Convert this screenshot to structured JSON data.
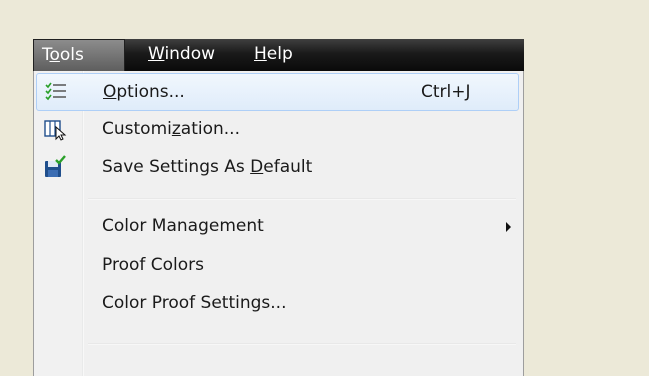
{
  "menubar": {
    "items": [
      {
        "pre": "T",
        "ul": "o",
        "post": "ols"
      },
      {
        "pre": "",
        "ul": "W",
        "post": "indow"
      },
      {
        "pre": "",
        "ul": "H",
        "post": "elp"
      }
    ]
  },
  "menu": {
    "items": [
      {
        "pre": "",
        "ul": "O",
        "post": "ptions...",
        "shortcut": "Ctrl+J",
        "icon": "options-checklist-icon"
      },
      {
        "pre": "Customi",
        "ul": "z",
        "post": "ation...",
        "icon": "customization-icon"
      },
      {
        "pre": "Save Settings As ",
        "ul": "D",
        "post": "efault",
        "icon": "save-settings-icon"
      },
      {
        "label": "Color Management"
      },
      {
        "label": "Proof Colors"
      },
      {
        "label": "Color Proof Settings..."
      }
    ]
  },
  "colors": {
    "menubar_bg": "#1a1a1a",
    "active_item_bg": "#6e6e6e",
    "menu_bg": "#f0f0f0",
    "highlight_border": "#aecff7",
    "icon_blue": "#1f4e8c",
    "icon_green": "#2aa02a"
  }
}
